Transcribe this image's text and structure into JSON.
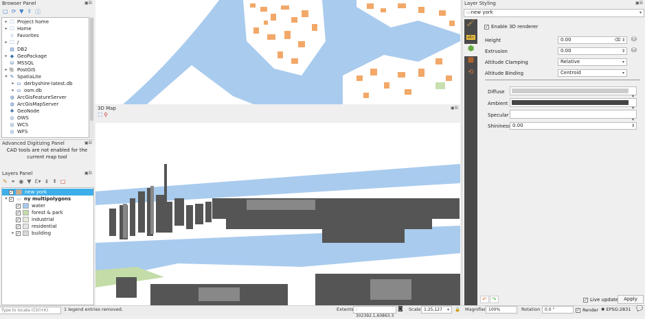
{
  "browser_panel": {
    "title": "Browser Panel",
    "items": [
      {
        "label": "Project home",
        "icon": "folder-icon",
        "arrow": "▸",
        "indent": 0
      },
      {
        "label": "Home",
        "icon": "folder-icon",
        "arrow": "▸",
        "indent": 0
      },
      {
        "label": "Favorites",
        "icon": "star-icon",
        "arrow": "",
        "indent": 0
      },
      {
        "label": "/",
        "icon": "folder-icon",
        "arrow": "▸",
        "indent": 0
      },
      {
        "label": "DB2",
        "icon": "db2-icon",
        "arrow": "",
        "indent": 0
      },
      {
        "label": "GeoPackage",
        "icon": "geopackage-icon",
        "arrow": "▸",
        "indent": 0
      },
      {
        "label": "MSSQL",
        "icon": "mssql-icon",
        "arrow": "",
        "indent": 0
      },
      {
        "label": "PostGIS",
        "icon": "postgis-icon",
        "arrow": "▸",
        "indent": 0
      },
      {
        "label": "SpatiaLite",
        "icon": "spatialite-icon",
        "arrow": "▾",
        "indent": 0
      },
      {
        "label": "derbyshire-latest.db",
        "icon": "database-icon",
        "arrow": "▸",
        "indent": 1
      },
      {
        "label": "osm.db",
        "icon": "database-icon",
        "arrow": "▸",
        "indent": 1
      },
      {
        "label": "ArcGisFeatureServer",
        "icon": "arcgis-icon",
        "arrow": "",
        "indent": 0
      },
      {
        "label": "ArcGisMapServer",
        "icon": "arcgis-icon",
        "arrow": "",
        "indent": 0
      },
      {
        "label": "GeoNode",
        "icon": "geonode-icon",
        "arrow": "",
        "indent": 0
      },
      {
        "label": "OWS",
        "icon": "globe-icon",
        "arrow": "",
        "indent": 0
      },
      {
        "label": "WCS",
        "icon": "globe-icon",
        "arrow": "",
        "indent": 0
      },
      {
        "label": "WFS",
        "icon": "globe-icon",
        "arrow": "",
        "indent": 0
      }
    ]
  },
  "adv_panel": {
    "title": "Advanced Digitizing Panel",
    "message": "CAD tools are not enabled for the current map tool"
  },
  "layers_panel": {
    "title": "Layers Panel",
    "layers": [
      {
        "label": "new york",
        "selected": true,
        "bold": false,
        "color": "#c9ad8c",
        "indent": 0,
        "arrow": ""
      },
      {
        "label": "ny multipolygons",
        "selected": false,
        "bold": true,
        "color": "",
        "indent": 0,
        "arrow": "▾"
      },
      {
        "label": "water",
        "color": "#a6c8ec",
        "indent": 1,
        "arrow": ""
      },
      {
        "label": "forest & park",
        "color": "#c4dca8",
        "indent": 1,
        "arrow": ""
      },
      {
        "label": "industrial",
        "color": "#e8e8dc",
        "indent": 1,
        "arrow": ""
      },
      {
        "label": "residential",
        "color": "#e4e4e4",
        "indent": 1,
        "arrow": ""
      },
      {
        "label": "building",
        "color": "#d8d8d8",
        "indent": 1,
        "arrow": "▸"
      }
    ]
  },
  "map3d": {
    "title": "3D Map"
  },
  "styling": {
    "title": "Layer Styling",
    "layer": "new york",
    "enable_3d": "Enable 3D renderer",
    "height_label": "Height",
    "height": "0.00",
    "extrusion_label": "Extrusion",
    "extrusion": "0.00",
    "clamping_label": "Altitude Clamping",
    "clamping": "Relative",
    "binding_label": "Altitude Binding",
    "binding": "Centroid",
    "diffuse_label": "Diffuse",
    "ambient_label": "Ambient",
    "specular_label": "Specular",
    "shininess_label": "Shininess",
    "shininess": "0.00",
    "diffuse_color": "#cccccc",
    "ambient_color": "#444444",
    "specular_color": "#ffffff",
    "live_update": "Live update",
    "apply": "Apply"
  },
  "status": {
    "locate_placeholder": "Type to locate (Ctrl+K)",
    "message": "1 legend entries removed.",
    "extents_label": "Extents:",
    "extents": ": 302392.1,60863.3",
    "scale_label": "Scale",
    "scale": "1:25,127",
    "magnifier_label": "Magnifier",
    "magnifier": "100%",
    "rotation_label": "Rotation",
    "rotation": "0.0 °",
    "render": "Render",
    "crs": "EPSG:2831"
  }
}
